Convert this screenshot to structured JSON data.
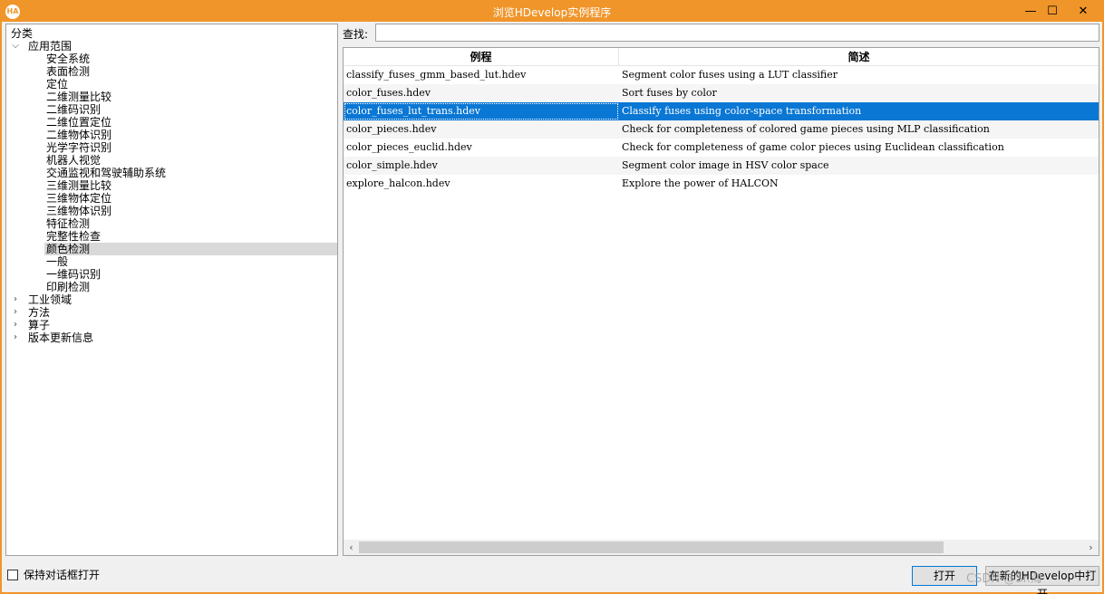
{
  "window": {
    "title": "浏览HDevelop实例程序",
    "app_icon_text": "HA",
    "minimize": "—",
    "maximize": "☐",
    "close": "✕"
  },
  "sidebar": {
    "header": "分类",
    "root_label": "应用范围",
    "children": [
      "安全系统",
      "表面检测",
      "定位",
      "二维测量比较",
      "二维码识别",
      "二维位置定位",
      "二维物体识别",
      "光学字符识别",
      "机器人视觉",
      "交通监视和驾驶辅助系统",
      "三维测量比较",
      "三维物体定位",
      "三维物体识别",
      "特征检测",
      "完整性检查",
      "颜色检测",
      "一般",
      "一维码识别",
      "印刷检测"
    ],
    "selected_child": "颜色检测",
    "other_roots": [
      "工业领域",
      "方法",
      "算子",
      "版本更新信息"
    ]
  },
  "search": {
    "label": "查找:",
    "value": "",
    "placeholder": ""
  },
  "table": {
    "columns": [
      "例程",
      "简述"
    ],
    "rows": [
      {
        "name": "classify_fuses_gmm_based_lut.hdev",
        "desc": "Segment color fuses using a LUT classifier"
      },
      {
        "name": "color_fuses.hdev",
        "desc": "Sort fuses by color"
      },
      {
        "name": "color_fuses_lut_trans.hdev",
        "desc": "Classify fuses using color-space transformation"
      },
      {
        "name": "color_pieces.hdev",
        "desc": "Check for completeness of colored game pieces using MLP classification"
      },
      {
        "name": "color_pieces_euclid.hdev",
        "desc": "Check for completeness of game color pieces using Euclidean classification"
      },
      {
        "name": "color_simple.hdev",
        "desc": "Segment color image in HSV color space"
      },
      {
        "name": "explore_halcon.hdev",
        "desc": "Explore the power of HALCON"
      }
    ],
    "selected_index": 2,
    "scroll_left_glyph": "‹",
    "scroll_right_glyph": "›"
  },
  "footer": {
    "keep_open_label": "保持对话框打开",
    "keep_open_checked": false,
    "open_button": "打开",
    "open_new_button": "在新的HDevelop中打开",
    "watermark": "CSDN @Sr.海"
  },
  "colors": {
    "titlebar": "#f0952a",
    "selection": "#0a77d4",
    "tree_selection": "#d9d9d9"
  },
  "icons": {
    "expanded": "chevron-down-icon",
    "collapsed": "chevron-right-icon"
  }
}
